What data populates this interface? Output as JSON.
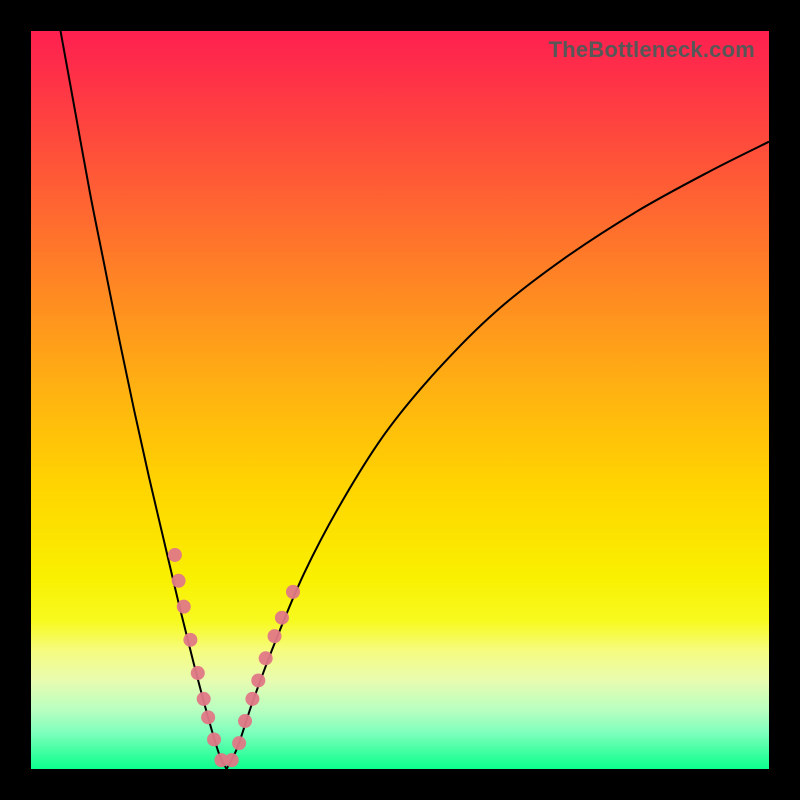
{
  "watermark": "TheBottleneck.com",
  "colors": {
    "frame": "#000000",
    "gradient_top": "#fe2050",
    "gradient_mid": "#ffd500",
    "gradient_bottom": "#0cff8e",
    "curve": "#000000",
    "marker": "#e07886"
  },
  "chart_data": {
    "type": "line",
    "title": "",
    "xlabel": "",
    "ylabel": "",
    "xlim": [
      0,
      100
    ],
    "ylim": [
      0,
      100
    ],
    "notes": "Bottleneck-style V curve; y is distance from optimal (0 = best, plotted at bottom). Two branches meeting near x≈26.",
    "series": [
      {
        "name": "left-branch",
        "x": [
          4,
          6,
          8,
          10,
          12,
          14,
          16,
          18,
          20,
          22,
          24,
          25.5,
          26.5
        ],
        "y": [
          100,
          89,
          78,
          68,
          58,
          48.5,
          39.5,
          31,
          22.5,
          14.5,
          7,
          2,
          0
        ]
      },
      {
        "name": "right-branch",
        "x": [
          26.5,
          28,
          30,
          33,
          37,
          42,
          48,
          55,
          63,
          72,
          82,
          92,
          100
        ],
        "y": [
          0,
          3,
          9,
          17,
          26.5,
          36,
          45.5,
          54,
          62,
          69,
          75.5,
          81,
          85
        ]
      }
    ],
    "markers": {
      "name": "highlighted-points",
      "radius": 7,
      "points": [
        {
          "x": 19.5,
          "y": 29
        },
        {
          "x": 20,
          "y": 25.5
        },
        {
          "x": 20.7,
          "y": 22
        },
        {
          "x": 21.6,
          "y": 17.5
        },
        {
          "x": 22.6,
          "y": 13
        },
        {
          "x": 23.4,
          "y": 9.5
        },
        {
          "x": 24,
          "y": 7
        },
        {
          "x": 24.8,
          "y": 4
        },
        {
          "x": 25.8,
          "y": 1.2
        },
        {
          "x": 27.2,
          "y": 1.2
        },
        {
          "x": 28.2,
          "y": 3.5
        },
        {
          "x": 29,
          "y": 6.5
        },
        {
          "x": 30,
          "y": 9.5
        },
        {
          "x": 30.8,
          "y": 12
        },
        {
          "x": 31.8,
          "y": 15
        },
        {
          "x": 33,
          "y": 18
        },
        {
          "x": 34,
          "y": 20.5
        },
        {
          "x": 35.5,
          "y": 24
        }
      ]
    }
  }
}
